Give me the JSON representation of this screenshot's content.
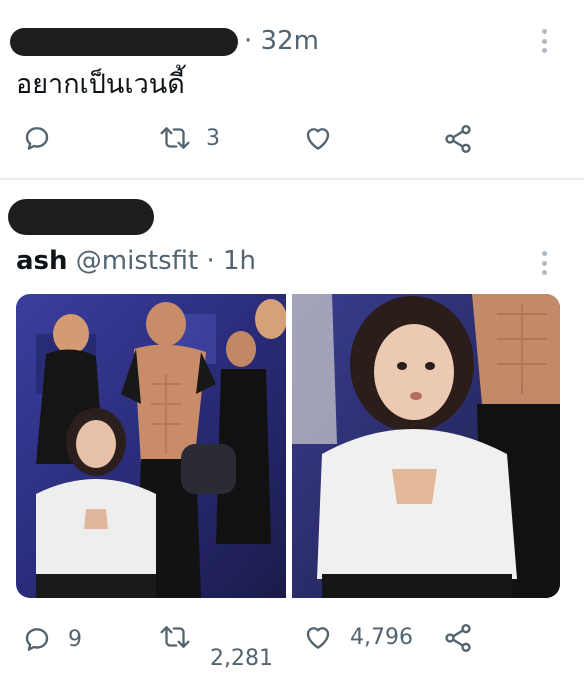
{
  "tweet1": {
    "time": "· 32m",
    "text": "อยากเป็นเวนดี้",
    "actions": {
      "retweet_count": "3"
    }
  },
  "tweet2": {
    "author_name": "ash",
    "handle": "@mistsfit",
    "time": "· 1h",
    "media": [
      {
        "alt": "photo-1"
      },
      {
        "alt": "photo-2"
      }
    ],
    "actions": {
      "reply_count": "9",
      "retweet_count": "2,281",
      "like_count": "4,796"
    }
  },
  "colors": {
    "icon": "#536471",
    "divider": "#e6ecf0",
    "redaction": "#1e1e1e"
  },
  "icons": [
    "reply-icon",
    "retweet-icon",
    "like-icon",
    "share-icon",
    "more-icon"
  ]
}
